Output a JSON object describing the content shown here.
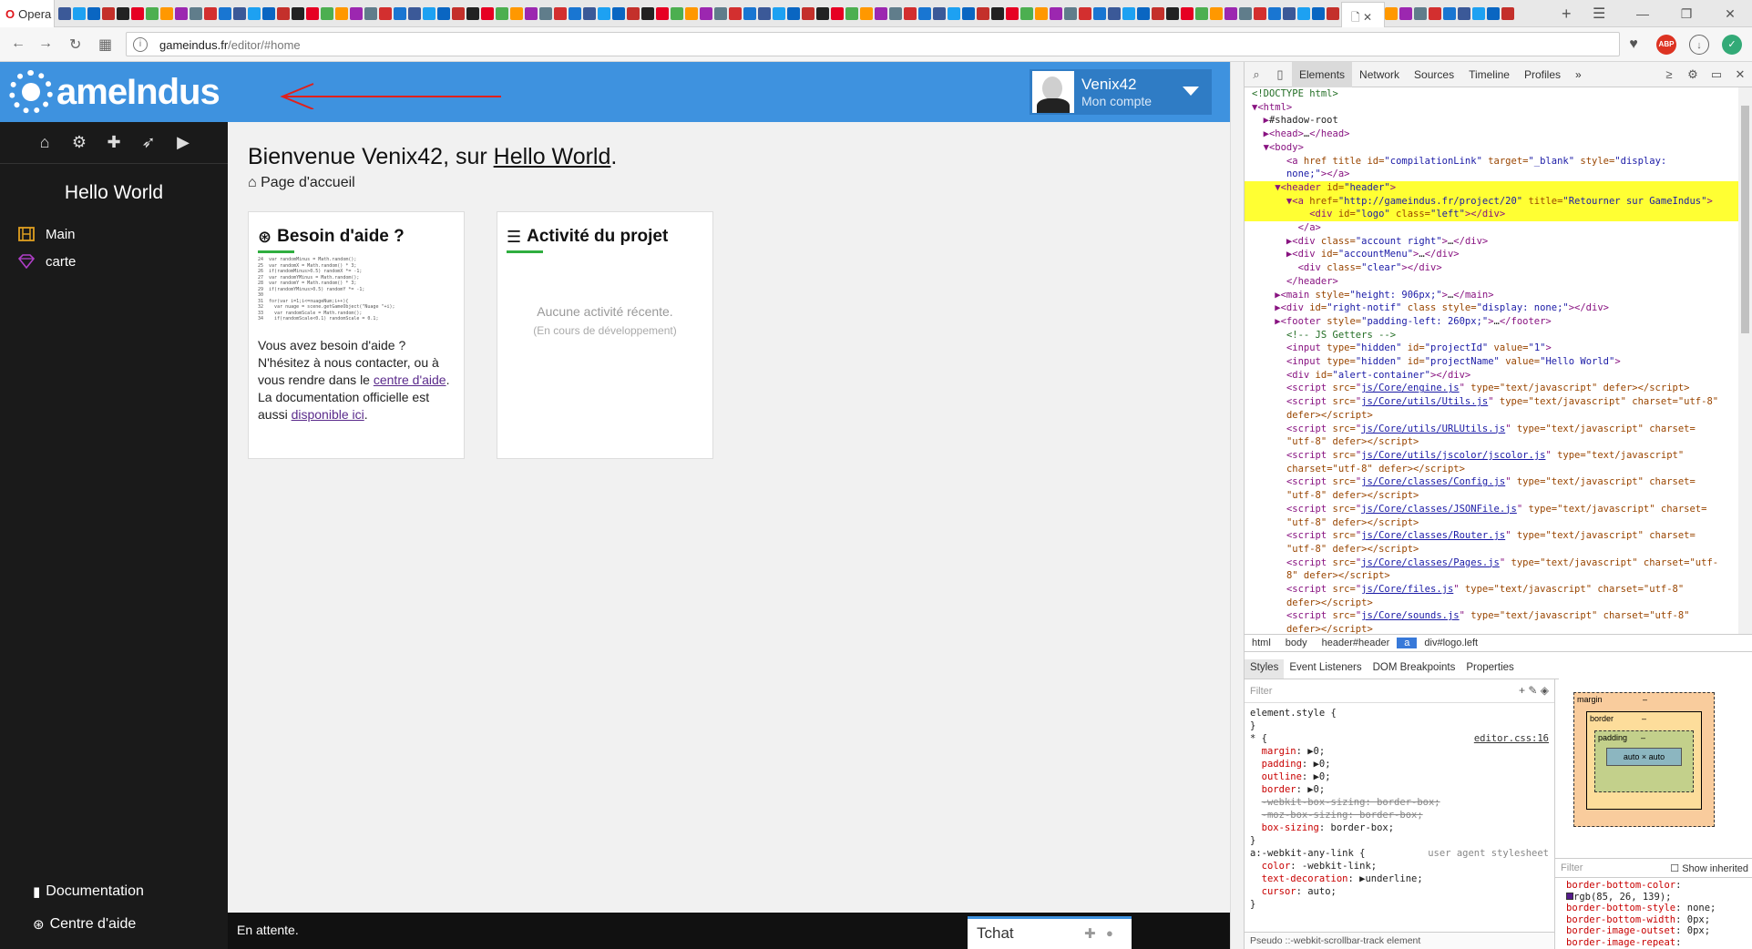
{
  "browser": {
    "menu_label": "Opera",
    "url_host": "gameindus.fr",
    "url_path": "/editor/#home",
    "new_tab": "+",
    "abp_badge": "ABP"
  },
  "site": {
    "logo_text": "ameIndus",
    "account": {
      "name": "Venix42",
      "sub": "Mon compte"
    }
  },
  "sidebar": {
    "project_name": "Hello World",
    "scenes": [
      {
        "label": "Main",
        "icon": "film-icon"
      },
      {
        "label": "carte",
        "icon": "gem-icon"
      }
    ],
    "bottom_links": [
      {
        "label": "Documentation",
        "icon": "book-icon"
      },
      {
        "label": "Centre d'aide",
        "icon": "lifebuoy-icon"
      }
    ]
  },
  "main": {
    "welcome_prefix": "Bienvenue Venix42, sur ",
    "welcome_project": "Hello World",
    "welcome_suffix": ".",
    "breadcrumb": "Page d'accueil",
    "help_card": {
      "title": "Besoin d'aide ?",
      "text1": "Vous avez besoin d'aide ? N'hésitez à nous contacter, ou à vous rendre dans le ",
      "link1": "centre d'aide",
      "text2": ". La documentation officielle est aussi ",
      "link2": "disponible ici",
      "text3": "."
    },
    "activity_card": {
      "title": "Activité du projet",
      "empty": "Aucune activité récente.",
      "dev": "(En cours de développement)"
    }
  },
  "statusbar": {
    "status": "En attente.",
    "tchat": "Tchat"
  },
  "devtools": {
    "tabs": [
      "Elements",
      "Network",
      "Sources",
      "Timeline",
      "Profiles"
    ],
    "breadcrumb": [
      "html",
      "body",
      "header#header",
      "a",
      "div#logo.left"
    ],
    "subtabs": [
      "Styles",
      "Event Listeners",
      "DOM Breakpoints",
      "Properties"
    ],
    "filter_placeholder": "Filter",
    "show_inherited": "Show inherited",
    "pseudo_bar": "Pseudo ::-webkit-scrollbar-track element",
    "boxmodel": {
      "margin": "margin",
      "border": "border",
      "padding": "padding",
      "content": "auto × auto",
      "dash": "–"
    }
  }
}
